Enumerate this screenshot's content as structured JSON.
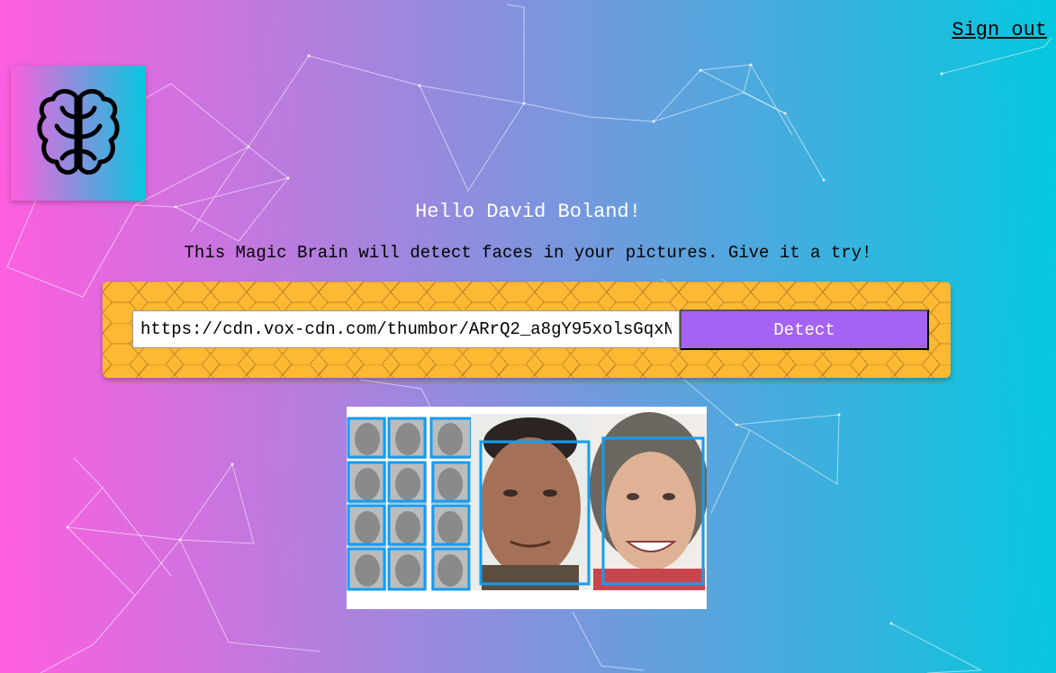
{
  "header": {
    "signout_label": "Sign out"
  },
  "logo": {
    "icon": "brain-icon"
  },
  "greeting": "Hello David Boland!",
  "tagline": "This Magic Brain will detect faces in your pictures. Give it a try!",
  "form": {
    "url_value": "https://cdn.vox-cdn.com/thumbor/ARrQ2_a8gY95xolsGqxN",
    "detect_label": "Detect"
  },
  "result": {
    "face_count": 14
  },
  "colors": {
    "gradient_start": "#ff5edf",
    "gradient_end": "#04c8de",
    "form_background": "#fdb932",
    "detect_button": "#a463f2",
    "face_box": "#149df2"
  }
}
